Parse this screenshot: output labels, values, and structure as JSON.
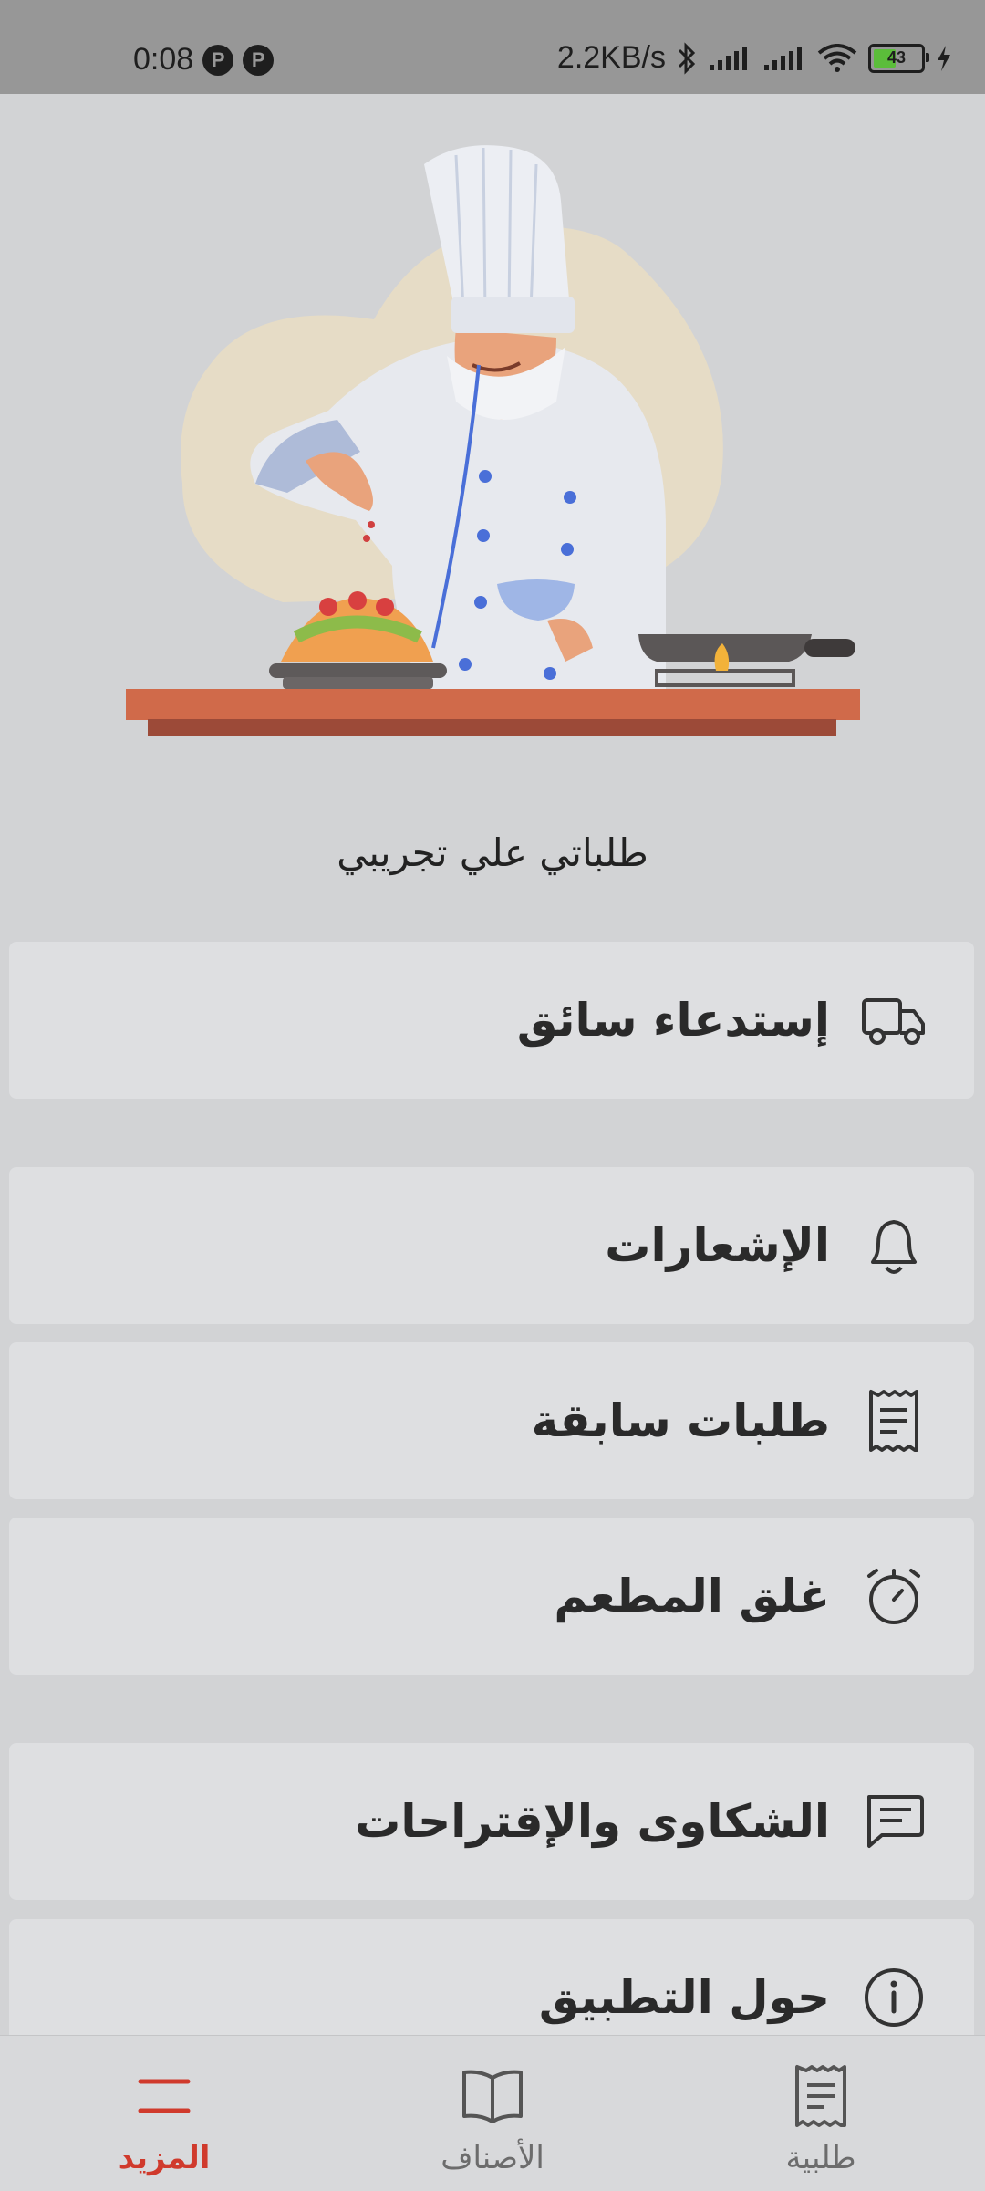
{
  "status_bar": {
    "time": "0:08",
    "network_speed": "2.2KB/s",
    "battery": "43"
  },
  "restaurant": {
    "name": "طلباتي علي تجريبي"
  },
  "menu": {
    "items": [
      {
        "label": "إستدعاء سائق",
        "icon": "truck-icon"
      },
      {
        "label": "الإشعارات",
        "icon": "bell-icon"
      },
      {
        "label": "طلبات سابقة",
        "icon": "receipt-icon"
      },
      {
        "label": "غلق المطعم",
        "icon": "stopwatch-icon"
      },
      {
        "label": "الشكاوى والإقتراحات",
        "icon": "message-icon"
      },
      {
        "label": "حول التطبيق",
        "icon": "info-icon"
      }
    ]
  },
  "bottom_nav": {
    "items": [
      {
        "label": "طلبية",
        "icon": "receipt-icon",
        "active": false
      },
      {
        "label": "الأصناف",
        "icon": "book-icon",
        "active": false
      },
      {
        "label": "المزيد",
        "icon": "menu-icon",
        "active": true
      }
    ],
    "active_color": "#d03a2c"
  }
}
